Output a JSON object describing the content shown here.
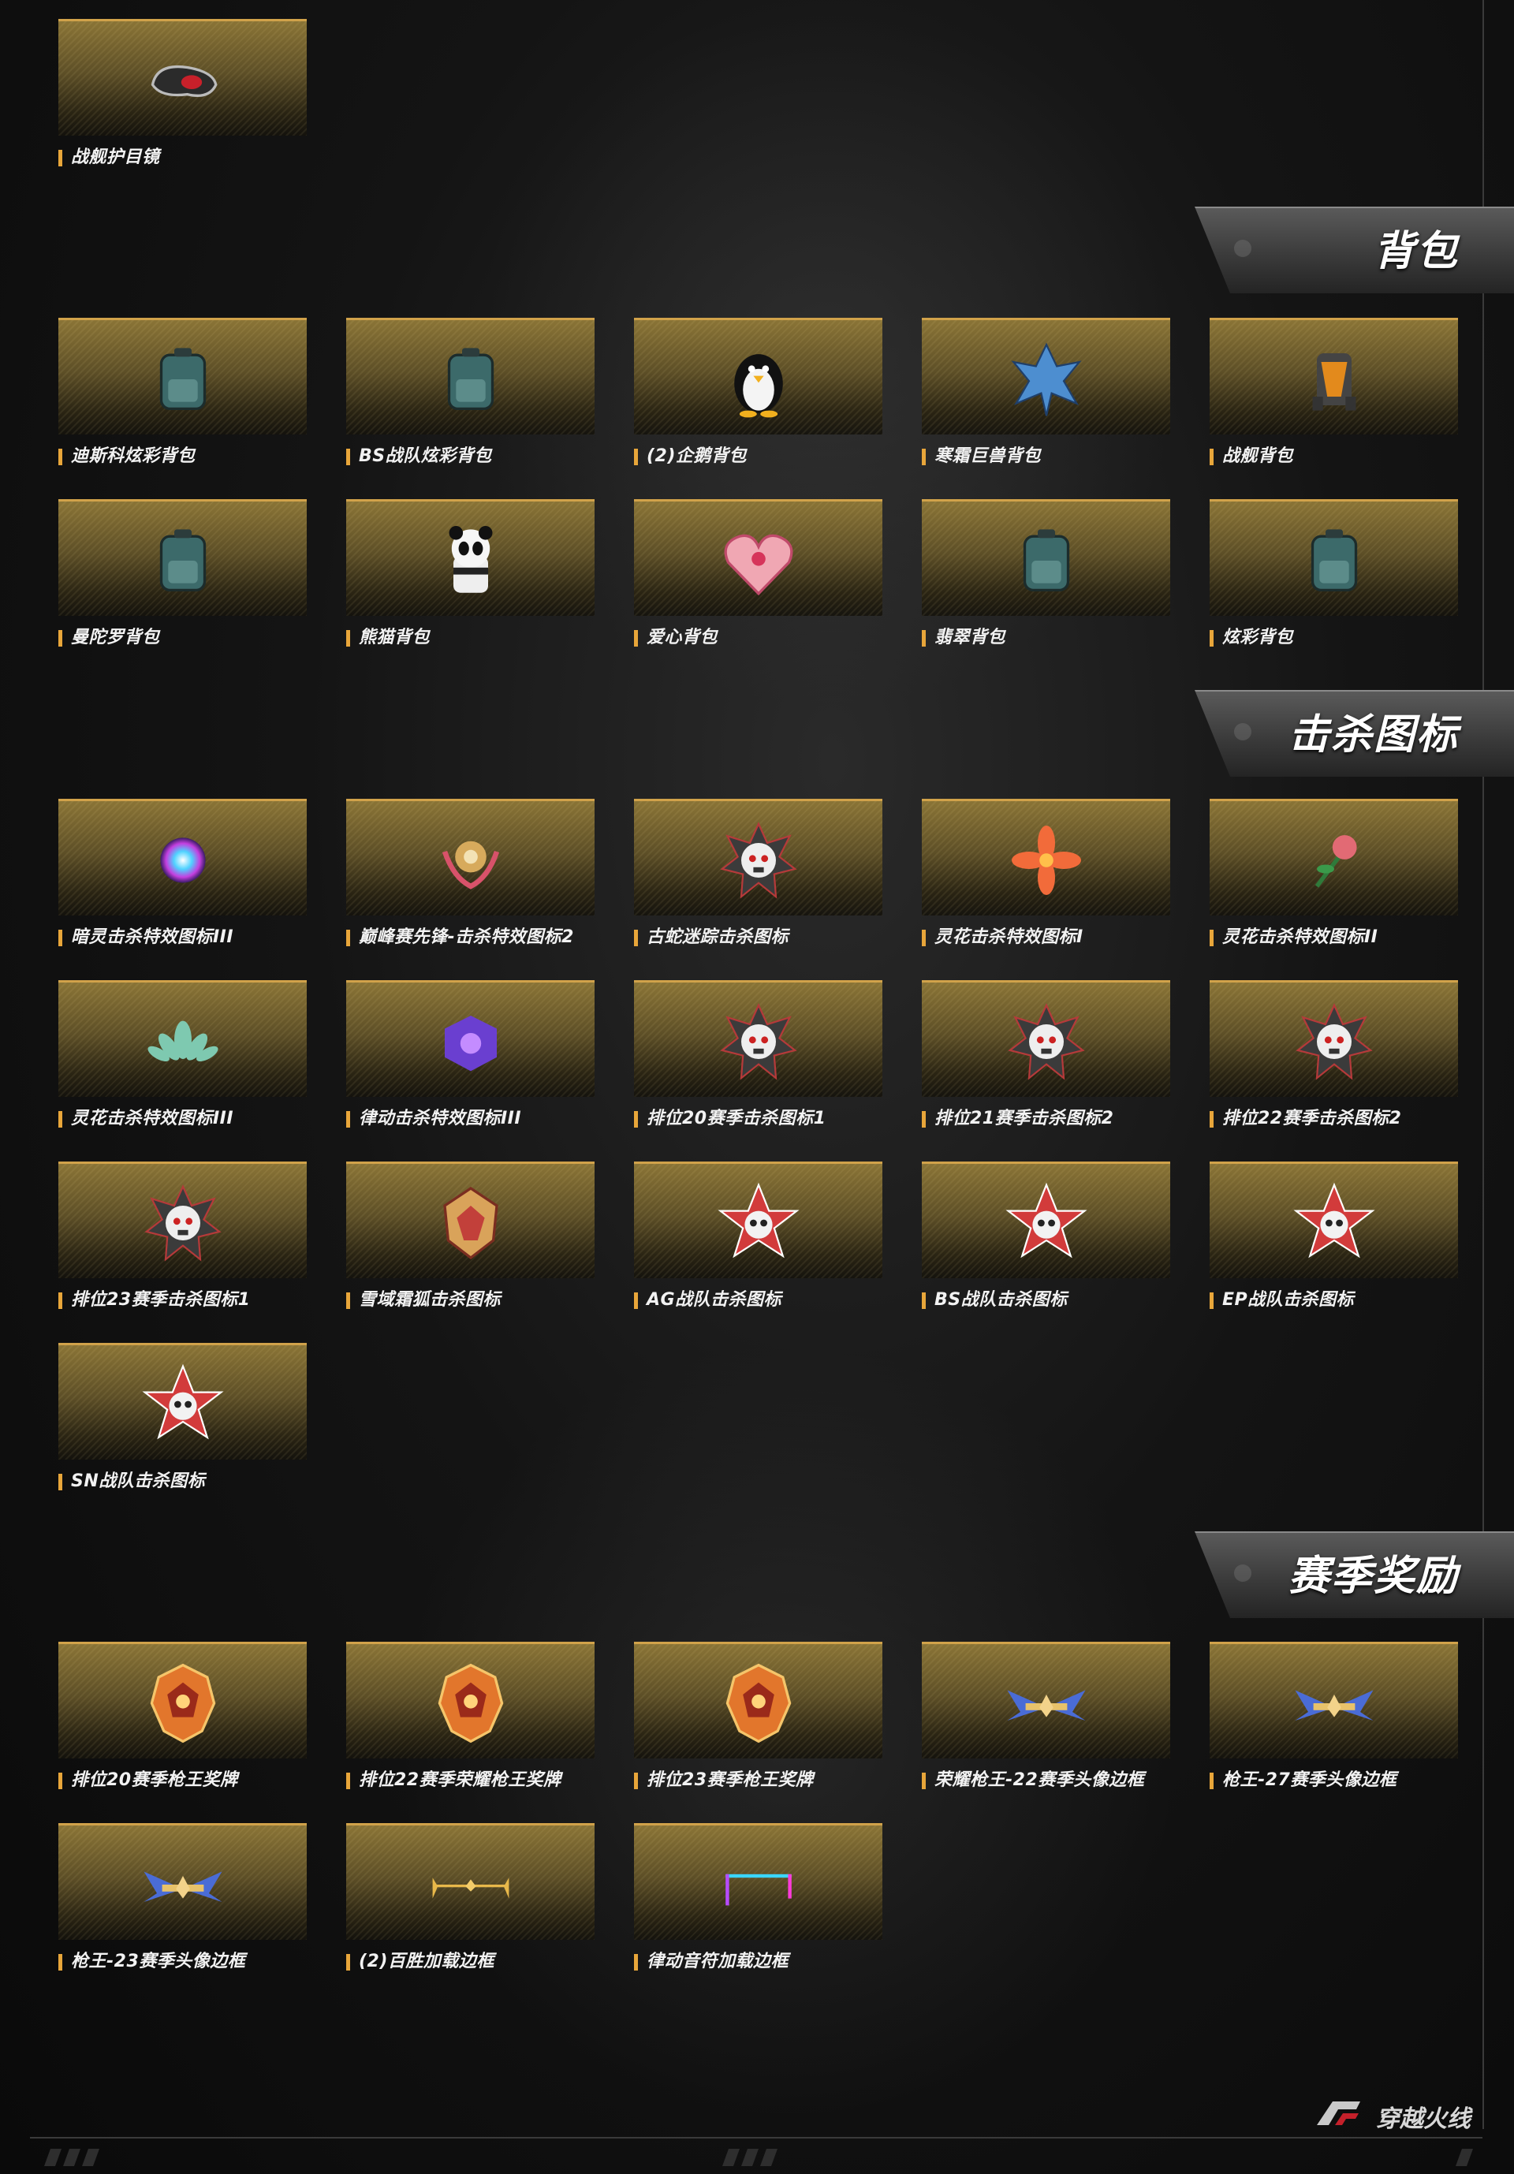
{
  "sections": {
    "goggles": {
      "items": [
        {
          "label": "战舰护目镜",
          "icon": "goggles-icon"
        }
      ]
    },
    "backpack": {
      "title": "背包",
      "items": [
        {
          "label": "迪斯科炫彩背包",
          "icon": "backpack-icon"
        },
        {
          "label": "BS战队炫彩背包",
          "icon": "backpack-icon"
        },
        {
          "label": "(2)企鹅背包",
          "icon": "penguin-icon"
        },
        {
          "label": "寒霜巨兽背包",
          "icon": "frost-beast-icon"
        },
        {
          "label": "战舰背包",
          "icon": "battleship-backpack-icon"
        },
        {
          "label": "曼陀罗背包",
          "icon": "backpack-icon"
        },
        {
          "label": "熊猫背包",
          "icon": "panda-icon"
        },
        {
          "label": "爱心背包",
          "icon": "heart-icon"
        },
        {
          "label": "翡翠背包",
          "icon": "backpack-icon"
        },
        {
          "label": "炫彩背包",
          "icon": "backpack-icon"
        }
      ]
    },
    "kill_icons": {
      "title": "击杀图标",
      "items": [
        {
          "label": "暗灵击杀特效图标III",
          "icon": "orb-icon"
        },
        {
          "label": "巅峰赛先锋-击杀特效图标2",
          "icon": "emblem-icon"
        },
        {
          "label": "古蛇迷踪击杀图标",
          "icon": "skull-badge-icon"
        },
        {
          "label": "灵花击杀特效图标I",
          "icon": "flower-icon"
        },
        {
          "label": "灵花击杀特效图标II",
          "icon": "rose-icon"
        },
        {
          "label": "灵花击杀特效图标III",
          "icon": "lotus-icon"
        },
        {
          "label": "律动击杀特效图标III",
          "icon": "cube-icon"
        },
        {
          "label": "排位20赛季击杀图标1",
          "icon": "skull-badge-icon"
        },
        {
          "label": "排位21赛季击杀图标2",
          "icon": "skull-badge-icon"
        },
        {
          "label": "排位22赛季击杀图标2",
          "icon": "skull-badge-icon"
        },
        {
          "label": "排位23赛季击杀图标1",
          "icon": "skull-badge-icon"
        },
        {
          "label": "雪域霜狐击杀图标",
          "icon": "fox-emblem-icon"
        },
        {
          "label": "AG战队击杀图标",
          "icon": "skull-star-icon"
        },
        {
          "label": "BS战队击杀图标",
          "icon": "skull-star-icon"
        },
        {
          "label": "EP战队击杀图标",
          "icon": "skull-star-icon"
        },
        {
          "label": "SN战队击杀图标",
          "icon": "skull-star-icon"
        }
      ]
    },
    "season_rewards": {
      "title": "赛季奖励",
      "items": [
        {
          "label": "排位20赛季枪王奖牌",
          "icon": "medal-icon"
        },
        {
          "label": "排位22赛季荣耀枪王奖牌",
          "icon": "medal-icon"
        },
        {
          "label": "排位23赛季枪王奖牌",
          "icon": "medal-icon"
        },
        {
          "label": "荣耀枪王-22赛季头像边框",
          "icon": "winged-frame-icon"
        },
        {
          "label": "枪王-27赛季头像边框",
          "icon": "winged-frame-icon"
        },
        {
          "label": "枪王-23赛季头像边框",
          "icon": "winged-frame-icon"
        },
        {
          "label": "(2)百胜加载边框",
          "icon": "loading-frame-icon"
        },
        {
          "label": "律动音符加载边框",
          "icon": "neon-frame-icon"
        }
      ]
    }
  },
  "footer": {
    "logo_text": "穿越火线",
    "logo_icon": "crossfire-logo-icon"
  },
  "colors": {
    "accent": "#e8a63a",
    "card_top": "#8a7436",
    "background": "#0f0f0f"
  }
}
